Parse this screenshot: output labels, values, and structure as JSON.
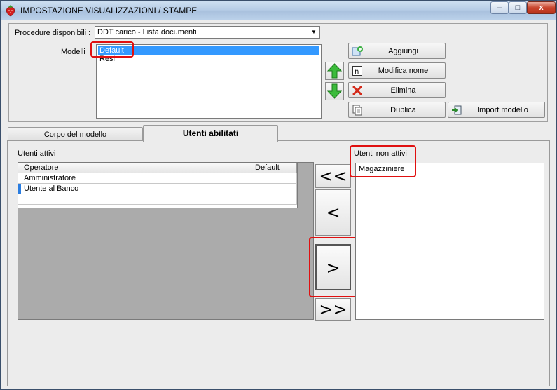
{
  "window": {
    "title": "IMPOSTAZIONE VISUALIZZAZIONI / STAMPE",
    "minimize": "–",
    "maximize": "□",
    "close": "x"
  },
  "top": {
    "procedure_label": "Procedure disponibili :",
    "procedure_value": "DDT carico - Lista documenti",
    "modelli_label": "Modelli",
    "modelli": [
      "Default",
      "Resi"
    ],
    "selected_modello": "Default"
  },
  "buttons": {
    "aggiungi": "Aggiungi",
    "modifica_nome": "Modifica nome",
    "elimina": "Elimina",
    "duplica": "Duplica",
    "import_modello": "Import modello"
  },
  "tabs": [
    {
      "label": "Corpo del modello",
      "active": false
    },
    {
      "label": "Utenti abilitati",
      "active": true
    }
  ],
  "utenti_attivi": {
    "label": "Utenti attivi",
    "columns": [
      "Operatore",
      "Default"
    ],
    "rows": [
      {
        "operatore": "Amministratore",
        "default": ""
      },
      {
        "operatore": "Utente al Banco",
        "default": ""
      }
    ]
  },
  "utenti_non_attivi": {
    "label": "Utenti non attivi",
    "items": [
      "Magazziniere"
    ]
  },
  "move_buttons": {
    "all_left": "<<",
    "left": "<",
    "right": ">",
    "all_right": ">>"
  },
  "colors": {
    "selection": "#3399ff",
    "highlight": "#e01010",
    "arrow_green": "#2fa82f"
  }
}
